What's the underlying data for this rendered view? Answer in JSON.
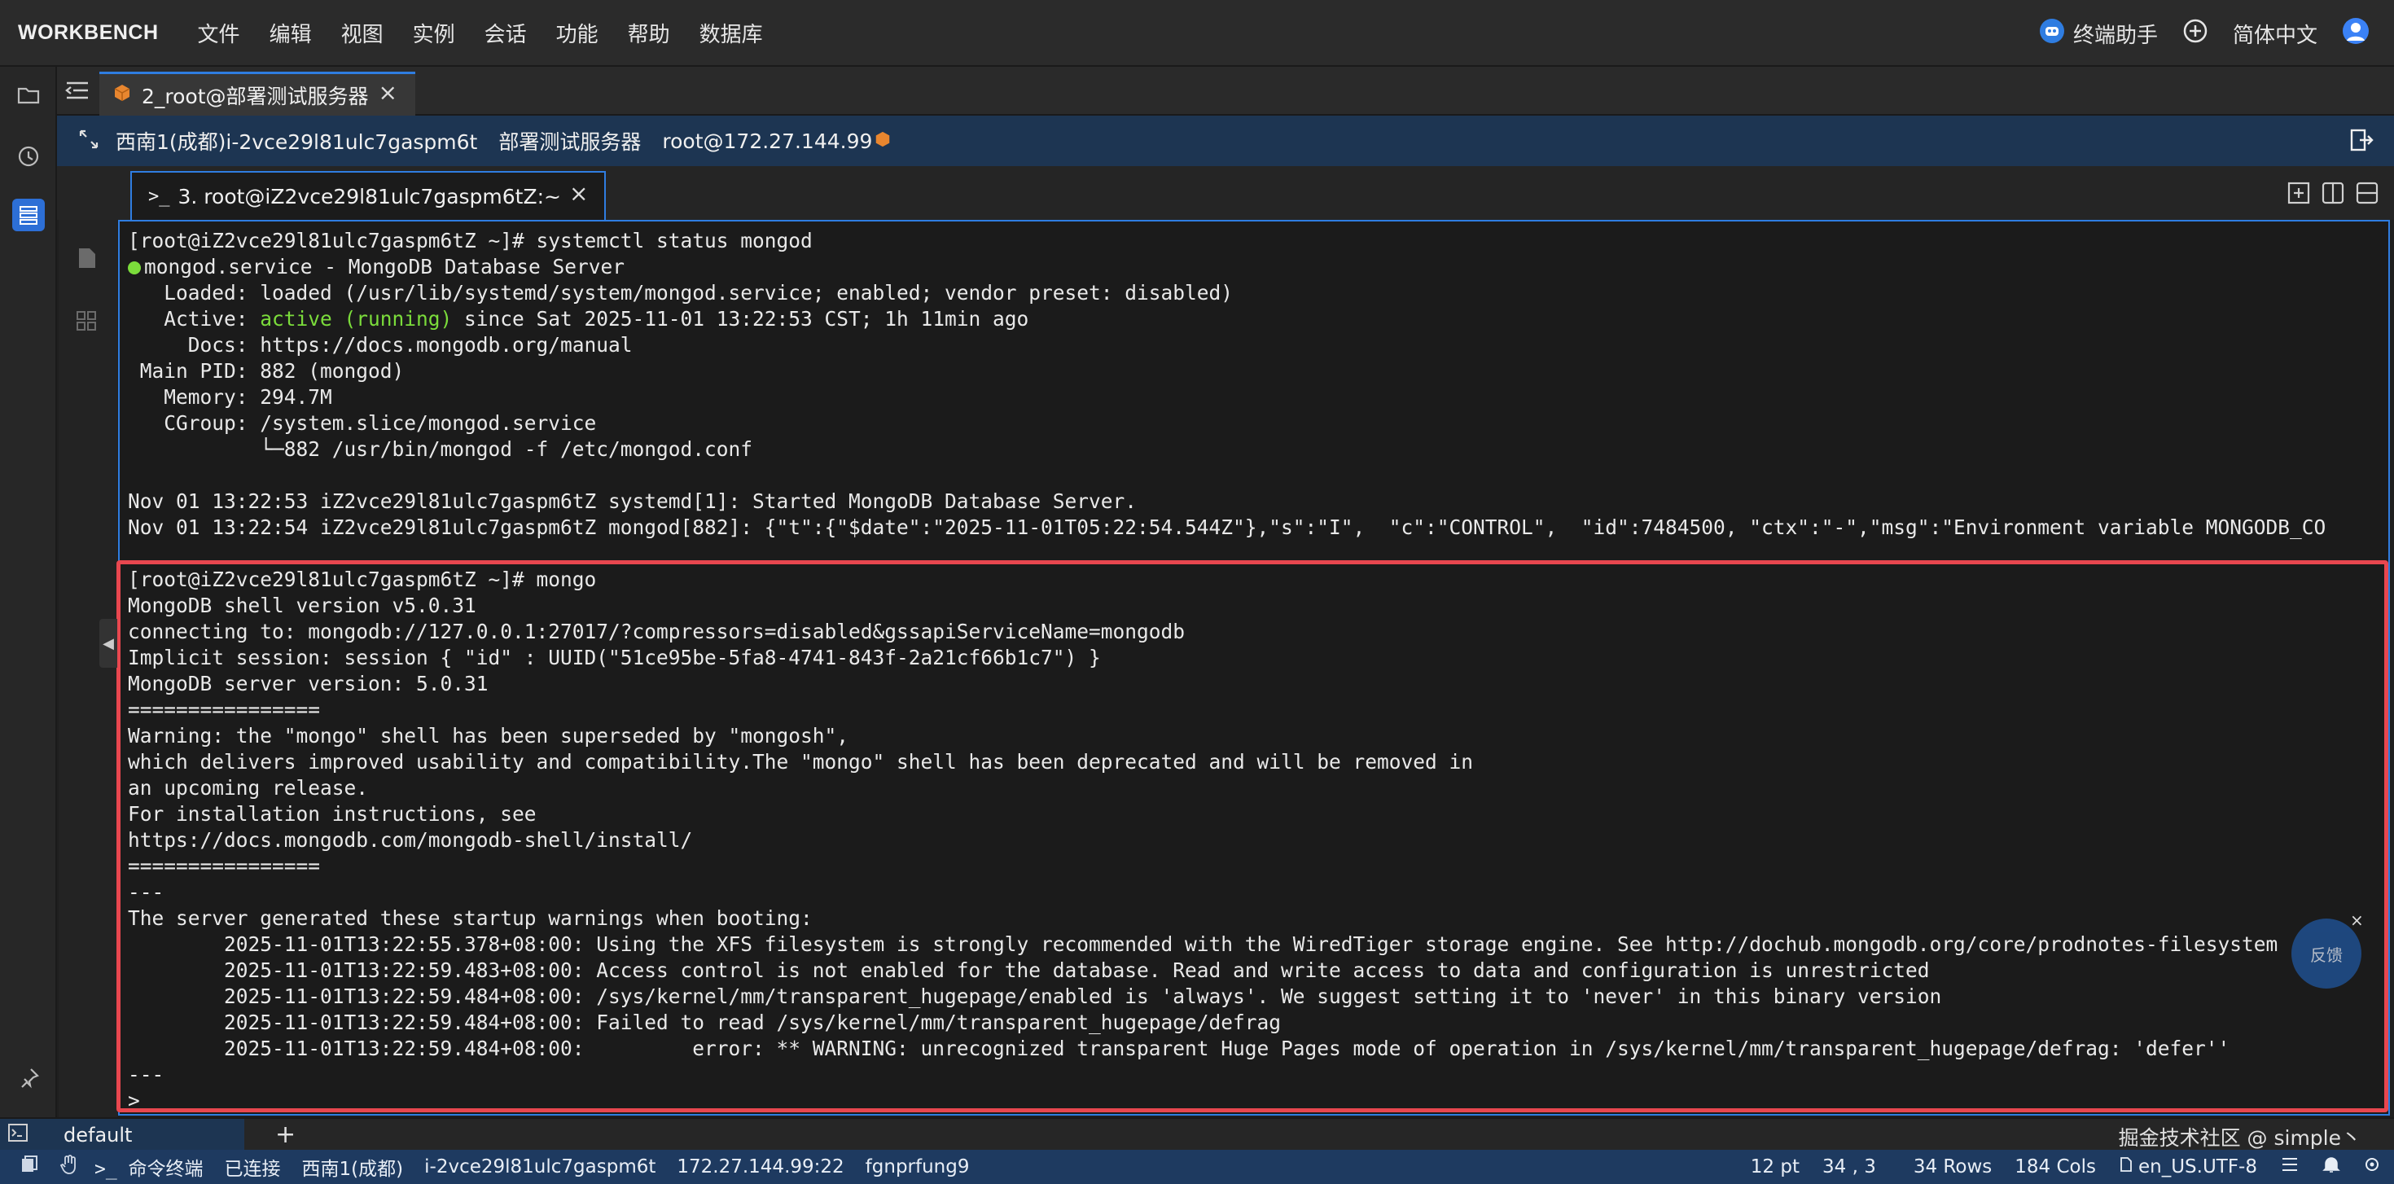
{
  "menubar": {
    "brand": "WORKBENCH",
    "items": [
      "文件",
      "编辑",
      "视图",
      "实例",
      "会话",
      "功能",
      "帮助",
      "数据库"
    ],
    "assistant": "终端助手",
    "language": "简体中文"
  },
  "tabs": [
    {
      "label": "2_root@部署测试服务器",
      "close": "×"
    }
  ],
  "session": {
    "region_instance": "西南1(成都)i-2vce29l81ulc7gaspm6t",
    "server_name": "部署测试服务器",
    "user_host": "root@172.27.144.99"
  },
  "inner_tab": {
    "label": "3. root@iZ2vce29l81ulc7gaspm6tZ:~",
    "close": "×"
  },
  "terminal": {
    "l01": "[root@iZ2vce29l81ulc7gaspm6tZ ~]# systemctl status mongod",
    "l02": "mongod.service - MongoDB Database Server",
    "l03": "   Loaded: loaded (/usr/lib/systemd/system/mongod.service; enabled; vendor preset: disabled)",
    "l04_pre": "   Active: ",
    "l04_status": "active (running)",
    "l04_post": " since Sat 2025-11-01 13:22:53 CST; 1h 11min ago",
    "l05": "     Docs: https://docs.mongodb.org/manual",
    "l06": " Main PID: 882 (mongod)",
    "l07": "   Memory: 294.7M",
    "l08": "   CGroup: /system.slice/mongod.service",
    "l09": "           └─882 /usr/bin/mongod -f /etc/mongod.conf",
    "l10": "",
    "l11": "Nov 01 13:22:53 iZ2vce29l81ulc7gaspm6tZ systemd[1]: Started MongoDB Database Server.",
    "l12": "Nov 01 13:22:54 iZ2vce29l81ulc7gaspm6tZ mongod[882]: {\"t\":{\"$date\":\"2025-11-01T05:22:54.544Z\"},\"s\":\"I\",  \"c\":\"CONTROL\",  \"id\":7484500, \"ctx\":\"-\",\"msg\":\"Environment variable MONGODB_CO",
    "m01": "[root@iZ2vce29l81ulc7gaspm6tZ ~]# mongo",
    "m02": "MongoDB shell version v5.0.31",
    "m03": "connecting to: mongodb://127.0.0.1:27017/?compressors=disabled&gssapiServiceName=mongodb",
    "m04": "Implicit session: session { \"id\" : UUID(\"51ce95be-5fa8-4741-843f-2a21cf66b1c7\") }",
    "m05": "MongoDB server version: 5.0.31",
    "m06": "================",
    "m07": "Warning: the \"mongo\" shell has been superseded by \"mongosh\",",
    "m08": "which delivers improved usability and compatibility.The \"mongo\" shell has been deprecated and will be removed in",
    "m09": "an upcoming release.",
    "m10": "For installation instructions, see",
    "m11": "https://docs.mongodb.com/mongodb-shell/install/",
    "m12": "================",
    "m13": "---",
    "m14": "The server generated these startup warnings when booting:",
    "m15": "        2025-11-01T13:22:55.378+08:00: Using the XFS filesystem is strongly recommended with the WiredTiger storage engine. See http://dochub.mongodb.org/core/prodnotes-filesystem",
    "m16": "        2025-11-01T13:22:59.483+08:00: Access control is not enabled for the database. Read and write access to data and configuration is unrestricted",
    "m17": "        2025-11-01T13:22:59.484+08:00: /sys/kernel/mm/transparent_hugepage/enabled is 'always'. We suggest setting it to 'never' in this binary version",
    "m18": "        2025-11-01T13:22:59.484+08:00: Failed to read /sys/kernel/mm/transparent_hugepage/defrag",
    "m19": "        2025-11-01T13:22:59.484+08:00:         error: ** WARNING: unrecognized transparent Huge Pages mode of operation in /sys/kernel/mm/transparent_hugepage/defrag: 'defer''",
    "m20": "---",
    "m21": ">"
  },
  "feedback": {
    "label": "反馈",
    "close": "×"
  },
  "bottom": {
    "session_name": "default",
    "add": "+",
    "watermark": "掘金技术社区 @ simple丶"
  },
  "status": {
    "terminal_label": "命令终端",
    "connected": "已连接",
    "region": "西南1(成都)",
    "instance": "i-2vce29l81ulc7gaspm6t",
    "address": "172.27.144.99:22",
    "code": "fgnprfung9",
    "font_size": "12 pt",
    "cursor": "34 , 3",
    "rows": "34 Rows",
    "cols": "184 Cols",
    "encoding": "en_US.UTF-8"
  },
  "colors": {
    "accent": "#2f7de1",
    "highlight": "#e8474f",
    "active_green": "#7bdc3b",
    "statusbar": "#1e3a60"
  }
}
